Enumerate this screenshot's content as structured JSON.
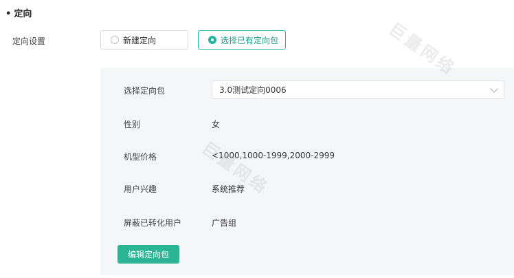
{
  "section": {
    "bullet": "•",
    "title": "定向"
  },
  "targeting": {
    "label": "定向设置",
    "options": [
      {
        "label": "新建定向",
        "selected": false
      },
      {
        "label": "选择已有定向包",
        "selected": true
      }
    ]
  },
  "panel": {
    "package_label": "选择定向包",
    "package_value": "3.0测试定向0006",
    "fields": [
      {
        "label": "性别",
        "value": "女"
      },
      {
        "label": "机型价格",
        "value": "<1000,1000-1999,2000-2999"
      },
      {
        "label": "用户兴趣",
        "value": "系统推荐"
      },
      {
        "label": "屏蔽已转化用户",
        "value": "广告组"
      }
    ],
    "edit_button": "编辑定向包"
  },
  "watermark": {
    "text": "巨量网络"
  },
  "colors": {
    "accent": "#2bb595",
    "panel_bg": "#f5f6f8"
  },
  "icons": {
    "dropdown": "chevron-down-icon"
  }
}
